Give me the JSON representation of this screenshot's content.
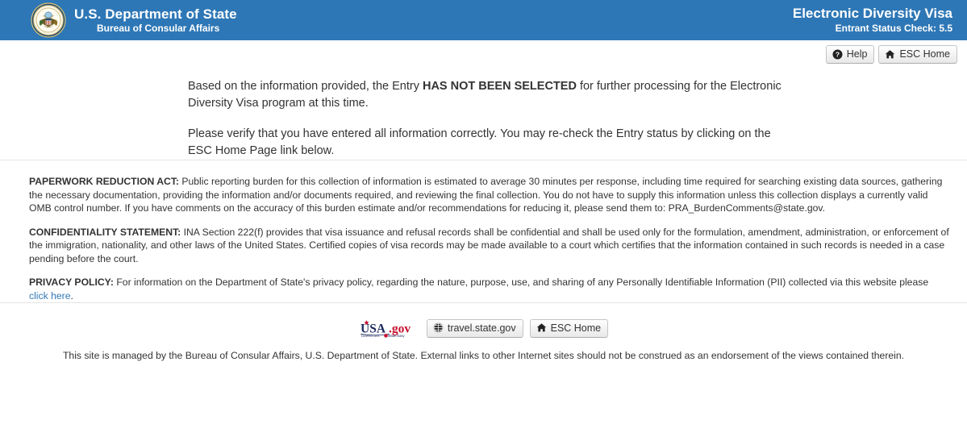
{
  "header": {
    "seal_icon": "great-seal-icon",
    "agency": "U.S. Department of State",
    "bureau": "Bureau of Consular Affairs",
    "app_title": "Electronic Diversity Visa",
    "app_version_line": "Entrant Status Check: 5.5",
    "background_color": "#2e77b6",
    "text_color": "#ffffff"
  },
  "toolbar": {
    "help_label": "Help",
    "help_icon": "question-circle-icon",
    "esc_home_label": "ESC Home",
    "esc_home_icon": "home-icon"
  },
  "main": {
    "paragraph1_before": "Based on the information provided, the Entry ",
    "paragraph1_emphasis": "HAS NOT BEEN SELECTED",
    "paragraph1_after": " for further processing for the Electronic Diversity Visa program at this time.",
    "paragraph2": "Please verify that you have entered all information correctly. You may re-check the Entry status by clicking on the ESC Home Page link below."
  },
  "legal": {
    "paperwork_label": "PAPERWORK REDUCTION ACT:",
    "paperwork_text": " Public reporting burden for this collection of information is estimated to average 30 minutes per response, including time required for searching existing data sources, gathering the necessary documentation, providing the information and/or documents required, and reviewing the final collection. You do not have to supply this information unless this collection displays a currently valid OMB control number. If you have comments on the accuracy of this burden estimate and/or recommendations for reducing it, please send them to: PRA_BurdenComments@state.gov.",
    "confidentiality_label": "CONFIDENTIALITY STATEMENT:",
    "confidentiality_text": " INA Section 222(f) provides that visa issuance and refusal records shall be confidential and shall be used only for the formulation, amendment, administration, or enforcement of the immigration, nationality, and other laws of the United States. Certified copies of visa records may be made available to a court which certifies that the information contained in such records is needed in a case pending before the court.",
    "privacy_label": "PRIVACY POLICY:",
    "privacy_text": " For information on the Department of State's privacy policy, regarding the nature, purpose, use, and sharing of any Personally Identifiable Information (PII) collected via this website please ",
    "privacy_link_text": "click here",
    "privacy_text_end": ".",
    "link_color": "#337ab7"
  },
  "footer": {
    "usagov_logo": "usagov-logo",
    "usagov_word": "USA",
    "usagov_suffix": ".gov",
    "usagov_tagline": "Government Made Easy",
    "travel_label": "travel.state.gov",
    "travel_icon": "globe-icon",
    "esc_home_label": "ESC Home",
    "esc_home_icon": "home-icon",
    "note": "This site is managed by the Bureau of Consular Affairs, U.S. Department of State. External links to other Internet sites should not be construed as an endorsement of the views contained therein."
  }
}
